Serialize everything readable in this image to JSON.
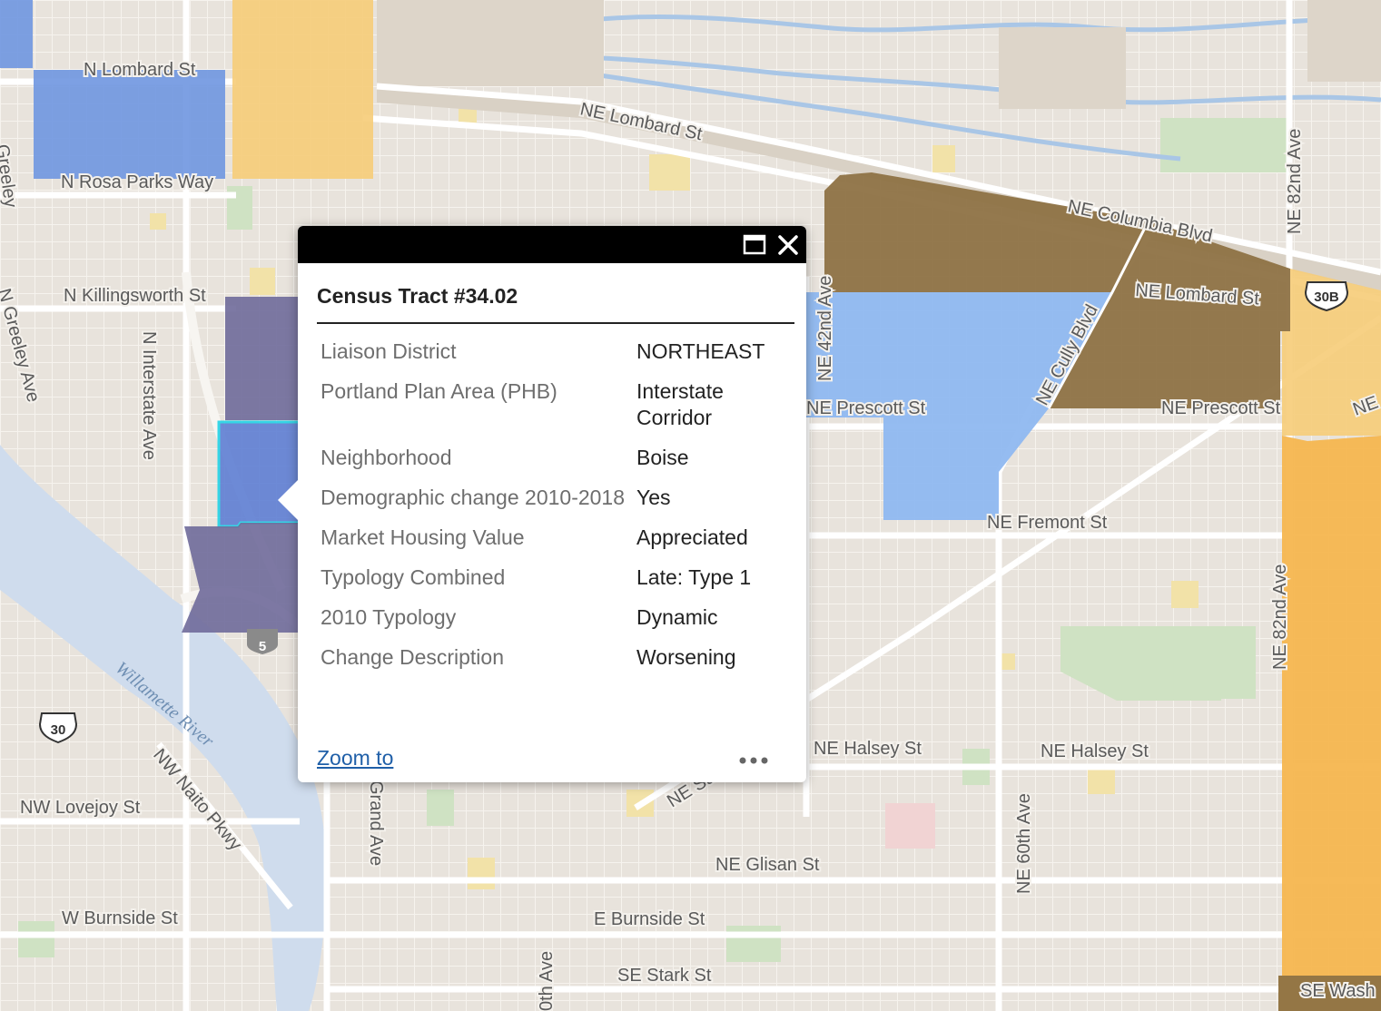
{
  "map": {
    "street_labels": [
      "N Lombard St",
      "N Rosa Parks Way",
      "N Killingsworth St",
      "N Interstate Ave",
      "N Greeley Ave",
      "Greeley",
      "NE Lombard St",
      "NE Columbia Blvd",
      "NE Lombard St",
      "NE 42nd Ave",
      "NE Cully Blvd",
      "NE 82nd Ave",
      "NE Prescott St",
      "NE Prescott St",
      "NE Fremont St",
      "NE 82nd Ave",
      "NE Halsey St",
      "NE Halsey St",
      "NE 60th Ave",
      "NE Glisan St",
      "E Burnside St",
      "SE Stark St",
      "W Burnside St",
      "NW Lovejoy St",
      "NW Naito Pkwy",
      "Grand Ave",
      "NE Sa",
      "SE Wash",
      "NE",
      "Ave",
      "0th"
    ],
    "water_labels": [
      "Willamette River"
    ],
    "route_shields": [
      "5",
      "30",
      "30B"
    ]
  },
  "colors": {
    "dark_purple": "#6f6a9a",
    "medium_blue": "#6f96e0",
    "light_blue": "#8fb8f0",
    "brown": "#8e7244",
    "orange": "#f5b64f",
    "light_orange": "#f6cc78",
    "selection": "#22d3e6",
    "link": "#1f5fa8"
  },
  "popup": {
    "title": "Census Tract #34.02",
    "zoom_label": "Zoom to",
    "attributes": [
      {
        "key": "Liaison District",
        "value": "NORTHEAST"
      },
      {
        "key": "Portland Plan Area (PHB)",
        "value": "Interstate Corridor"
      },
      {
        "key": "Neighborhood",
        "value": "Boise"
      },
      {
        "key": "Demographic change 2010-2018",
        "value": "Yes"
      },
      {
        "key": "Market Housing Value",
        "value": "Appreciated"
      },
      {
        "key": "Typology Combined",
        "value": "Late: Type 1"
      },
      {
        "key": "2010 Typology",
        "value": "Dynamic"
      },
      {
        "key": "Change Description",
        "value": "Worsening"
      }
    ]
  }
}
